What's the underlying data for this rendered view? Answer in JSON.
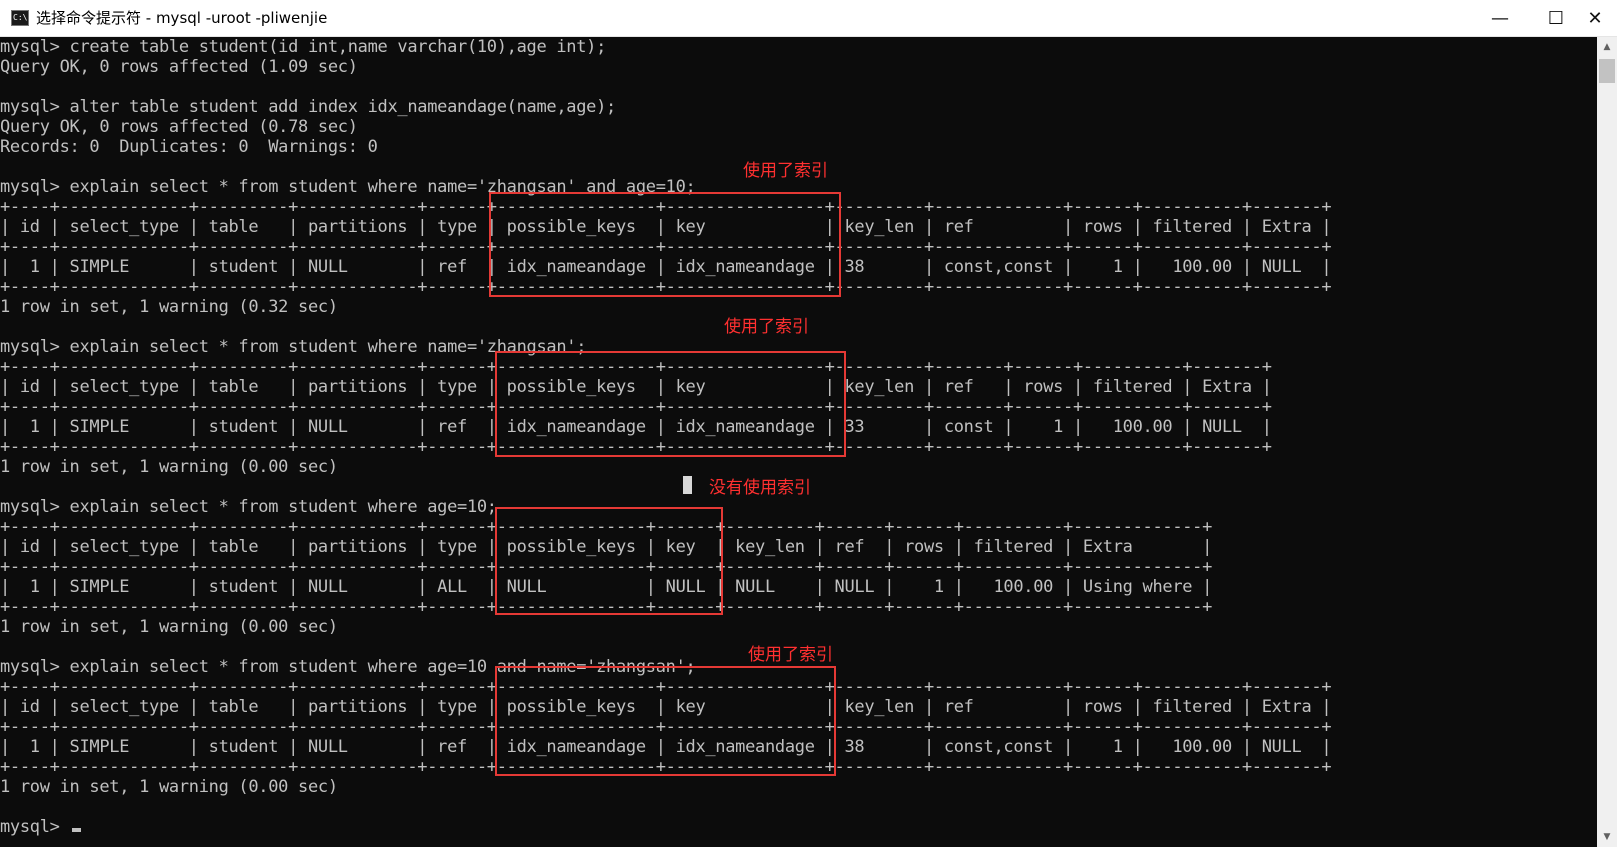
{
  "window": {
    "title": "选择命令提示符 - mysql  -uroot -pliwenjie",
    "icon": "cmd-icon",
    "icon_text": "C:\\",
    "controls": {
      "minimize": "—",
      "maximize": "☐",
      "close": "✕"
    }
  },
  "console": {
    "prompt_final": "mysql> ",
    "lines": [
      "mysql> create table student(id int,name varchar(10),age int);",
      "Query OK, 0 rows affected (1.09 sec)",
      "",
      "mysql> alter table student add index idx_nameandage(name,age);",
      "Query OK, 0 rows affected (0.78 sec)",
      "Records: 0  Duplicates: 0  Warnings: 0",
      "",
      "mysql> explain select * from student where name='zhangsan' and age=10;",
      "+----+-------------+---------+------------+------+----------------+----------------+---------+-------------+------+----------+-------+",
      "| id | select_type | table   | partitions | type | possible_keys  | key            | key_len | ref         | rows | filtered | Extra |",
      "+----+-------------+---------+------------+------+----------------+----------------+---------+-------------+------+----------+-------+",
      "|  1 | SIMPLE      | student | NULL       | ref  | idx_nameandage | idx_nameandage | 38      | const,const |    1 |   100.00 | NULL  |",
      "+----+-------------+---------+------------+------+----------------+----------------+---------+-------------+------+----------+-------+",
      "1 row in set, 1 warning (0.32 sec)",
      "",
      "mysql> explain select * from student where name='zhangsan';",
      "+----+-------------+---------+------------+------+----------------+----------------+---------+-------+------+----------+-------+",
      "| id | select_type | table   | partitions | type | possible_keys  | key            | key_len | ref   | rows | filtered | Extra |",
      "+----+-------------+---------+------------+------+----------------+----------------+---------+-------+------+----------+-------+",
      "|  1 | SIMPLE      | student | NULL       | ref  | idx_nameandage | idx_nameandage | 33      | const |    1 |   100.00 | NULL  |",
      "+----+-------------+---------+------------+------+----------------+----------------+---------+-------+------+----------+-------+",
      "1 row in set, 1 warning (0.00 sec)",
      "",
      "mysql> explain select * from student where age=10;",
      "+----+-------------+---------+------------+------+---------------+------+---------+------+------+----------+-------------+",
      "| id | select_type | table   | partitions | type | possible_keys | key  | key_len | ref  | rows | filtered | Extra       |",
      "+----+-------------+---------+------------+------+---------------+------+---------+------+------+----------+-------------+",
      "|  1 | SIMPLE      | student | NULL       | ALL  | NULL          | NULL | NULL    | NULL |    1 |   100.00 | Using where |",
      "+----+-------------+---------+------------+------+---------------+------+---------+------+------+----------+-------------+",
      "1 row in set, 1 warning (0.00 sec)",
      "",
      "mysql> explain select * from student where age=10 and name='zhangsan';",
      "+----+-------------+---------+------------+------+----------------+----------------+---------+-------------+------+----------+-------+",
      "| id | select_type | table   | partitions | type | possible_keys  | key            | key_len | ref         | rows | filtered | Extra |",
      "+----+-------------+---------+------------+------+----------------+----------------+---------+-------------+------+----------+-------+",
      "|  1 | SIMPLE      | student | NULL       | ref  | idx_nameandage | idx_nameandage | 38      | const,const |    1 |   100.00 | NULL  |",
      "+----+-------------+---------+------------+------+----------------+----------------+---------+-------------+------+----------+-------+",
      "1 row in set, 1 warning (0.00 sec)",
      ""
    ]
  },
  "annotations": {
    "query1": "使用了索引",
    "query2": "使用了索引",
    "query3": "没有使用索引",
    "query4": "使用了索引",
    "color": "#e53935"
  },
  "scrollbar": {
    "up_arrow": "▲",
    "down_arrow": "▼"
  }
}
